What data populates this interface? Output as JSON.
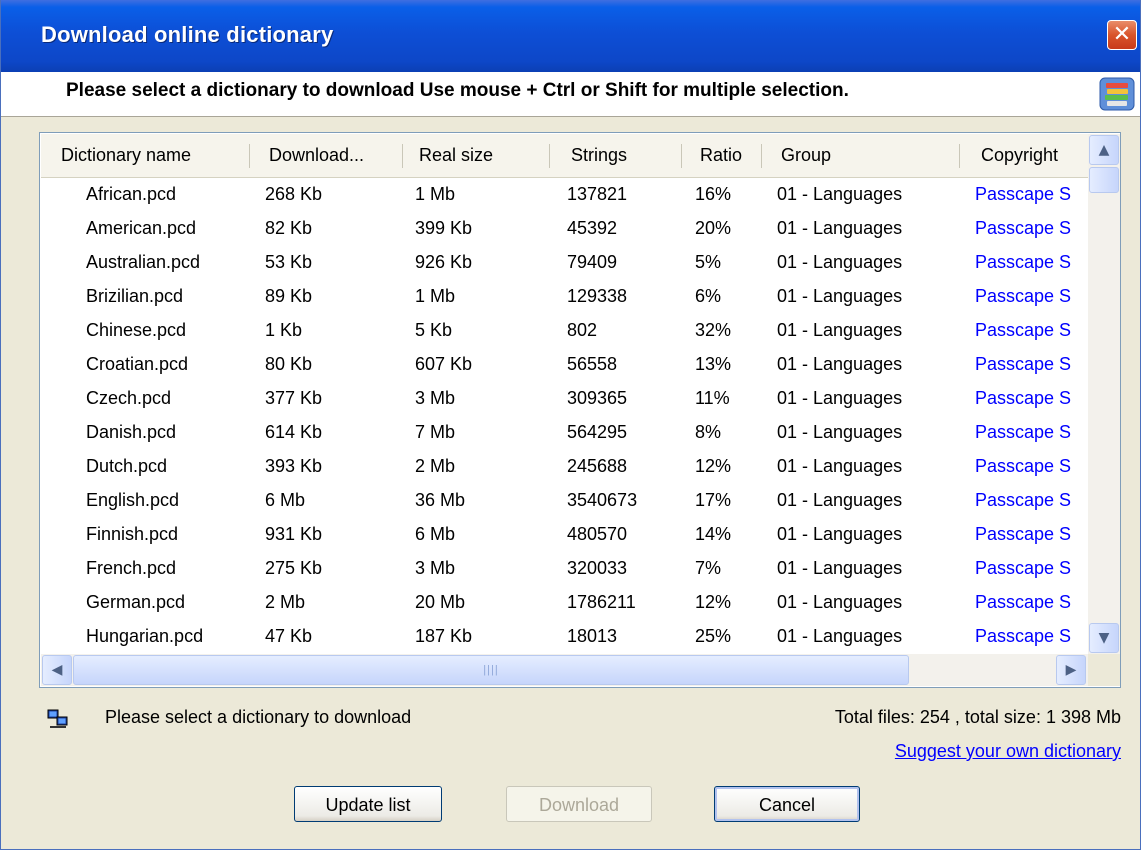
{
  "window": {
    "title": "Download online dictionary",
    "instruction": "Please select a dictionary to download Use mouse + Ctrl or Shift for multiple selection."
  },
  "columns": [
    "Dictionary name",
    "Download...",
    "Real size",
    "Strings",
    "Ratio",
    "Group",
    "Copyright"
  ],
  "rows": [
    {
      "name": "African.pcd",
      "download": "268 Kb",
      "real": "1 Mb",
      "strings": "137821",
      "ratio": "16%",
      "group": "01 - Languages",
      "copyright": "Passcape S"
    },
    {
      "name": "American.pcd",
      "download": "82 Kb",
      "real": "399 Kb",
      "strings": "45392",
      "ratio": "20%",
      "group": "01 - Languages",
      "copyright": "Passcape S"
    },
    {
      "name": "Australian.pcd",
      "download": "53 Kb",
      "real": "926 Kb",
      "strings": "79409",
      "ratio": "5%",
      "group": "01 - Languages",
      "copyright": "Passcape S"
    },
    {
      "name": "Brizilian.pcd",
      "download": "89 Kb",
      "real": "1 Mb",
      "strings": "129338",
      "ratio": "6%",
      "group": "01 - Languages",
      "copyright": "Passcape S"
    },
    {
      "name": "Chinese.pcd",
      "download": "1 Kb",
      "real": "5 Kb",
      "strings": "802",
      "ratio": "32%",
      "group": "01 - Languages",
      "copyright": "Passcape S"
    },
    {
      "name": "Croatian.pcd",
      "download": "80 Kb",
      "real": "607 Kb",
      "strings": "56558",
      "ratio": "13%",
      "group": "01 - Languages",
      "copyright": "Passcape S"
    },
    {
      "name": "Czech.pcd",
      "download": "377 Kb",
      "real": "3 Mb",
      "strings": "309365",
      "ratio": "11%",
      "group": "01 - Languages",
      "copyright": "Passcape S"
    },
    {
      "name": "Danish.pcd",
      "download": "614 Kb",
      "real": "7 Mb",
      "strings": "564295",
      "ratio": "8%",
      "group": "01 - Languages",
      "copyright": "Passcape S"
    },
    {
      "name": "Dutch.pcd",
      "download": "393 Kb",
      "real": "2 Mb",
      "strings": "245688",
      "ratio": "12%",
      "group": "01 - Languages",
      "copyright": "Passcape S"
    },
    {
      "name": "English.pcd",
      "download": "6 Mb",
      "real": "36 Mb",
      "strings": "3540673",
      "ratio": "17%",
      "group": "01 - Languages",
      "copyright": "Passcape S"
    },
    {
      "name": "Finnish.pcd",
      "download": "931 Kb",
      "real": "6 Mb",
      "strings": "480570",
      "ratio": "14%",
      "group": "01 - Languages",
      "copyright": "Passcape S"
    },
    {
      "name": "French.pcd",
      "download": "275 Kb",
      "real": "3 Mb",
      "strings": "320033",
      "ratio": "7%",
      "group": "01 - Languages",
      "copyright": "Passcape S"
    },
    {
      "name": "German.pcd",
      "download": "2 Mb",
      "real": "20 Mb",
      "strings": "1786211",
      "ratio": "12%",
      "group": "01 - Languages",
      "copyright": "Passcape S"
    },
    {
      "name": "Hungarian.pcd",
      "download": "47 Kb",
      "real": "187 Kb",
      "strings": "18013",
      "ratio": "25%",
      "group": "01 - Languages",
      "copyright": "Passcape S"
    }
  ],
  "status": {
    "message": "Please select a dictionary to download",
    "totals": "Total files: 254 ,  total size: 1 398  Mb",
    "suggest_link": "Suggest your own dictionary"
  },
  "buttons": {
    "update": "Update list",
    "download": "Download",
    "cancel": "Cancel"
  },
  "icons": {
    "close": "close-icon",
    "books": "books-icon",
    "network": "network-computers-icon"
  },
  "colors": {
    "titlebar": "#0d4fd6",
    "dialog_bg": "#ECE9D8",
    "link": "#0000ff",
    "close_button": "#d9542b"
  }
}
